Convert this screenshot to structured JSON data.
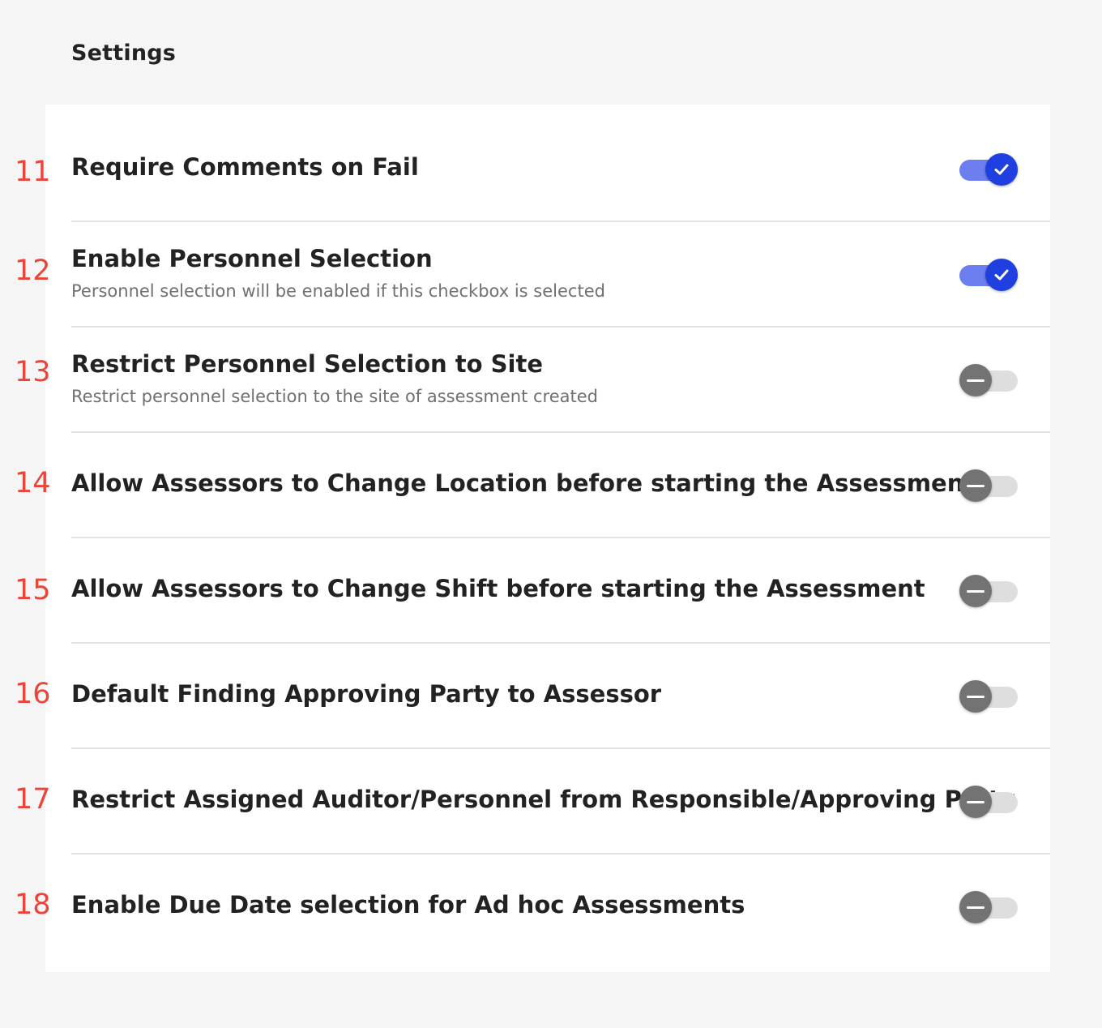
{
  "page": {
    "title": "Settings"
  },
  "colors": {
    "track_on": "#6d7ff0",
    "knob_on": "#1f3fe0",
    "track_off": "#dedede",
    "knob_off": "#737373",
    "number_annotation": "#e8463a"
  },
  "settings": [
    {
      "number": "11",
      "title": "Require Comments on Fail",
      "description": "",
      "enabled": true,
      "icon": "check-icon"
    },
    {
      "number": "12",
      "title": "Enable Personnel Selection",
      "description": "Personnel selection will be enabled if this checkbox is selected",
      "enabled": true,
      "icon": "check-icon"
    },
    {
      "number": "13",
      "title": "Restrict Personnel Selection to Site",
      "description": "Restrict personnel selection to the site of assessment created",
      "enabled": false,
      "icon": "minus-icon"
    },
    {
      "number": "14",
      "title": "Allow Assessors to Change Location before starting the Assessment",
      "description": "",
      "enabled": false,
      "icon": "minus-icon"
    },
    {
      "number": "15",
      "title": "Allow Assessors to Change Shift before starting the Assessment",
      "description": "",
      "enabled": false,
      "icon": "minus-icon"
    },
    {
      "number": "16",
      "title": "Default Finding Approving Party to Assessor",
      "description": "",
      "enabled": false,
      "icon": "minus-icon"
    },
    {
      "number": "17",
      "title": "Restrict Assigned Auditor/Personnel from Responsible/Approving Party",
      "description": "",
      "enabled": false,
      "icon": "minus-icon"
    },
    {
      "number": "18",
      "title": "Enable Due Date selection for Ad hoc Assessments",
      "description": "",
      "enabled": false,
      "icon": "minus-icon"
    }
  ]
}
